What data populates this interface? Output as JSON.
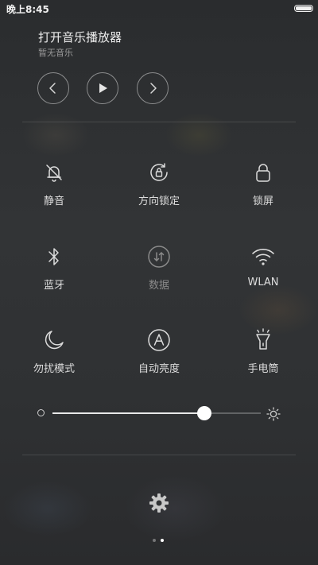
{
  "status_bar": {
    "time": "晚上8:45",
    "battery_icon": "battery-icon"
  },
  "music": {
    "title": "打开音乐播放器",
    "subtitle": "暂无音乐",
    "controls": [
      "previous-icon",
      "play-icon",
      "next-icon"
    ]
  },
  "toggles": [
    {
      "label": "静音",
      "icon": "bell-off-icon",
      "enabled": true
    },
    {
      "label": "方向锁定",
      "icon": "rotation-lock-icon",
      "enabled": true
    },
    {
      "label": "锁屏",
      "icon": "lock-icon",
      "enabled": true
    },
    {
      "label": "蓝牙",
      "icon": "bluetooth-icon",
      "enabled": true
    },
    {
      "label": "数据",
      "icon": "mobile-data-icon",
      "enabled": false
    },
    {
      "label": "WLAN",
      "icon": "wifi-icon",
      "enabled": true
    },
    {
      "label": "勿扰模式",
      "icon": "moon-icon",
      "enabled": true
    },
    {
      "label": "自动亮度",
      "icon": "auto-brightness-icon",
      "enabled": true
    },
    {
      "label": "手电筒",
      "icon": "flashlight-icon",
      "enabled": true
    }
  ],
  "brightness": {
    "level": 0.73,
    "low_icon": "brightness-low-icon",
    "high_icon": "brightness-high-icon"
  },
  "footer": {
    "settings_icon": "gear-icon",
    "pages": 2,
    "current_page": 2
  },
  "colors": {
    "text": "#e6e6e6",
    "muted": "#9a9a9a",
    "disabled": "#8a8a8a",
    "accent": "#ffffff"
  }
}
